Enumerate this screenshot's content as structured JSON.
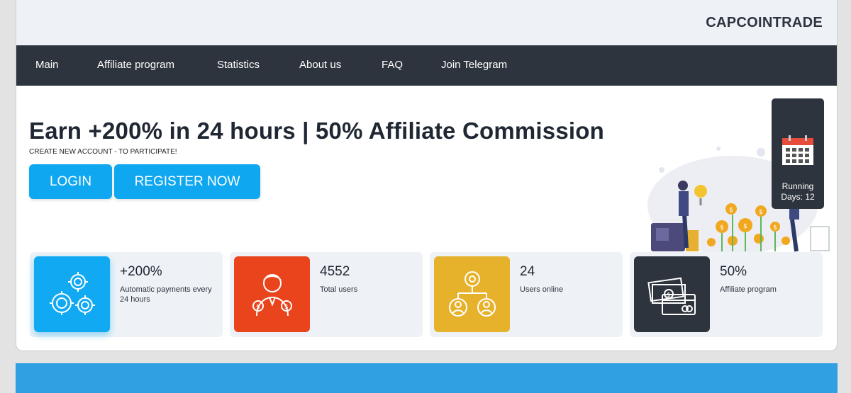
{
  "brand": "CAPCOINTRADE",
  "nav": [
    "Main",
    "Affiliate program",
    "Statistics",
    "About us",
    "FAQ",
    "Join Telegram"
  ],
  "hero": {
    "title": "Earn +200% in 24 hours | 50% Affiliate Commission",
    "subtitle": "CREATE NEW ACCOUNT - TO PARTICIPATE!",
    "login_label": "LOGIN",
    "register_label": "REGISTER NOW"
  },
  "running": {
    "line1": "Running",
    "line2": "Days: 12",
    "icon": "calendar-icon"
  },
  "stats": [
    {
      "value": "+200%",
      "label": "Automatic payments every 24 hours",
      "color": "#11a9f2",
      "icon": "gears-dollar-icon"
    },
    {
      "value": "4552",
      "label": "Total users",
      "color": "#e9441c",
      "icon": "investor-icon"
    },
    {
      "value": "24",
      "label": "Users online",
      "color": "#e7b22b",
      "icon": "network-users-icon"
    },
    {
      "value": "50%",
      "label": "Affiliate program",
      "color": "#2e343d",
      "icon": "money-card-icon"
    }
  ],
  "colors": {
    "nav_bg": "#2e343d",
    "accent": "#0fa7f0",
    "band": "#30a0e3"
  }
}
